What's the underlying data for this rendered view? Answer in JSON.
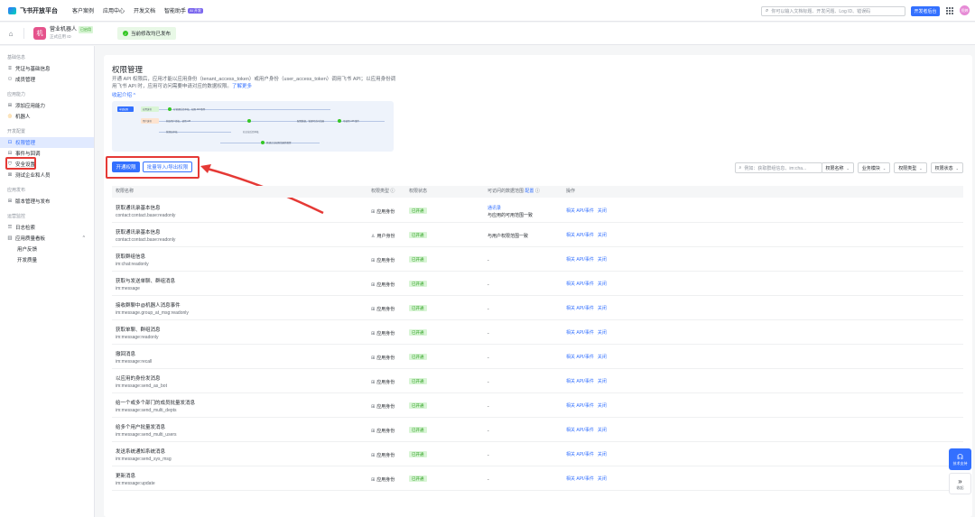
{
  "topnav": {
    "logo_text": "飞书开放平台",
    "links": [
      "客户案例",
      "应用中心",
      "开发文档",
      "智能助手"
    ],
    "ai_badge": "AI 开发",
    "search_placeholder": "你可以输入文档标题、开发问题、Log ID、错误码",
    "console_button": "开发者后台",
    "user_avatar_text": "倪婷"
  },
  "apphead": {
    "app_avatar_text": "机",
    "app_name": "营业机器人",
    "app_status": "已启用",
    "app_id": "正式应用 ID",
    "publish_banner": "当前修改均已发布"
  },
  "sidebar": {
    "groups": [
      {
        "title": "基础信息",
        "items": [
          {
            "icon": "key-icon",
            "glyph": "⌸",
            "label": "凭证与基础信息"
          },
          {
            "icon": "member-icon",
            "glyph": "⚇",
            "label": "成员管理"
          }
        ]
      },
      {
        "title": "应用能力",
        "items": [
          {
            "icon": "add-icon",
            "glyph": "⊞",
            "label": "添加应用能力"
          },
          {
            "icon": "robot-icon",
            "glyph": "◎",
            "label": "机器人"
          }
        ]
      },
      {
        "title": "开发配置",
        "items": [
          {
            "icon": "lock-icon",
            "glyph": "⊡",
            "label": "权限管理"
          },
          {
            "icon": "event-icon",
            "glyph": "⊟",
            "label": "事件与回调"
          },
          {
            "icon": "shield-icon",
            "glyph": "⛉",
            "label": "安全设置"
          },
          {
            "icon": "test-icon",
            "glyph": "⊠",
            "label": "测试企业和人员"
          }
        ]
      },
      {
        "title": "应用发布",
        "items": [
          {
            "icon": "version-icon",
            "glyph": "⊞",
            "label": "版本管理与发布"
          }
        ]
      },
      {
        "title": "运营监控",
        "items": [
          {
            "icon": "log-icon",
            "glyph": "☰",
            "label": "日志检索"
          },
          {
            "icon": "chart-icon",
            "glyph": "▥",
            "label": "应用质量看板"
          },
          {
            "label": "用户反馈"
          },
          {
            "label": "开发质量"
          }
        ]
      }
    ]
  },
  "main": {
    "title": "权限管理",
    "desc": "开通 API 权限后，应用才能以应用身份（tenant_access_token）或用户身份（user_access_token）调用飞书 API；以应用身份调用飞书 API 时，应用可访问需要申请对应的数据权限。",
    "desc_link": "了解更多",
    "collapse_label": "收起介绍 ^",
    "flow": {
      "start": "申请权限",
      "app_token": "应用身份",
      "user_token": "用户身份",
      "step_app": "在管理后台审核、权限 API/事件",
      "step_user": "获取用户授权，调用 API",
      "step_range": "配置数据、管理可访问范围",
      "step_done": "可调用 API/事件",
      "step_admin": "管理员审核",
      "step_tenant": "在企业后台审核",
      "step_final": "开通企业权限范围并配置"
    },
    "btn_open": "开通权限",
    "btn_batch": "批量导入/导出权限",
    "filters": {
      "search_placeholder": "例如：获取群组信息、im:cha...",
      "name_select": "权限名称",
      "biz_select": "业务模块",
      "type_select": "权限类型",
      "status_select": "权限状态"
    },
    "table": {
      "headers": {
        "name": "权限名称",
        "type": "权限类型",
        "status": "权限状态",
        "range": "可访问的数据范围",
        "range_link": "配置",
        "ops": "操作"
      },
      "rows": [
        {
          "name": "获取通讯录基本信息",
          "code": "contact:contact.base:readonly",
          "type": "应用身份",
          "type_icon": "app-identity-icon",
          "status": "已开通",
          "range1": "通讯录",
          "range2": "与应用的可用范围一致",
          "ops": [
            "相关 API/事件",
            "关闭"
          ]
        },
        {
          "name": "获取通讯录基本信息",
          "code": "contact:contact.base:readonly",
          "type": "用户身份",
          "type_icon": "user-identity-icon",
          "status": "已开通",
          "range1": "",
          "range2": "与用户权限范围一致",
          "ops": [
            "相关 API/事件",
            "关闭"
          ]
        },
        {
          "name": "获取群组信息",
          "code": "im:chat:readonly",
          "type": "应用身份",
          "type_icon": "app-identity-icon",
          "status": "已开通",
          "range1": "-",
          "range2": "",
          "ops": [
            "相关 API/事件",
            "关闭"
          ]
        },
        {
          "name": "获取与发送单聊、群组消息",
          "code": "im:message",
          "type": "应用身份",
          "type_icon": "app-identity-icon",
          "status": "已开通",
          "range1": "-",
          "range2": "",
          "ops": [
            "相关 API/事件",
            "关闭"
          ]
        },
        {
          "name": "接收群聊中@机器人消息事件",
          "code": "im:message.group_at_msg:readonly",
          "type": "应用身份",
          "type_icon": "app-identity-icon",
          "status": "已开通",
          "range1": "-",
          "range2": "",
          "ops": [
            "相关 API/事件",
            "关闭"
          ]
        },
        {
          "name": "获取单聊、群组消息",
          "code": "im:message:readonly",
          "type": "应用身份",
          "type_icon": "app-identity-icon",
          "status": "已开通",
          "range1": "-",
          "range2": "",
          "ops": [
            "相关 API/事件",
            "关闭"
          ]
        },
        {
          "name": "撤回消息",
          "code": "im:message:recall",
          "type": "应用身份",
          "type_icon": "app-identity-icon",
          "status": "已开通",
          "range1": "-",
          "range2": "",
          "ops": [
            "相关 API/事件",
            "关闭"
          ]
        },
        {
          "name": "以应用的身份发消息",
          "code": "im:message:send_as_bot",
          "type": "应用身份",
          "type_icon": "app-identity-icon",
          "status": "已开通",
          "range1": "-",
          "range2": "",
          "ops": [
            "相关 API/事件",
            "关闭"
          ]
        },
        {
          "name": "给一个或多个部门的成员批量发消息",
          "code": "im:message:send_multi_depts",
          "type": "应用身份",
          "type_icon": "app-identity-icon",
          "status": "已开通",
          "range1": "-",
          "range2": "",
          "ops": [
            "相关 API/事件",
            "关闭"
          ]
        },
        {
          "name": "给多个用户批量发消息",
          "code": "im:message:send_multi_users",
          "type": "应用身份",
          "type_icon": "app-identity-icon",
          "status": "已开通",
          "range1": "-",
          "range2": "",
          "ops": [
            "相关 API/事件",
            "关闭"
          ]
        },
        {
          "name": "发送系统通知系统消息",
          "code": "im:message:send_sys_msg",
          "type": "应用身份",
          "type_icon": "app-identity-icon",
          "status": "已开通",
          "range1": "-",
          "range2": "",
          "ops": [
            "相关 API/事件",
            "关闭"
          ]
        },
        {
          "name": "更新消息",
          "code": "im:message:update",
          "type": "应用身份",
          "type_icon": "app-identity-icon",
          "status": "已开通",
          "range1": "-",
          "range2": "",
          "ops": [
            "相关 API/事件",
            "关闭"
          ]
        }
      ]
    }
  },
  "widgets": {
    "support_label": "技术支持",
    "collapse_label": "收起"
  },
  "colors": {
    "accent": "#3370ff",
    "success": "#2ea121",
    "highlight": "#e53935"
  }
}
